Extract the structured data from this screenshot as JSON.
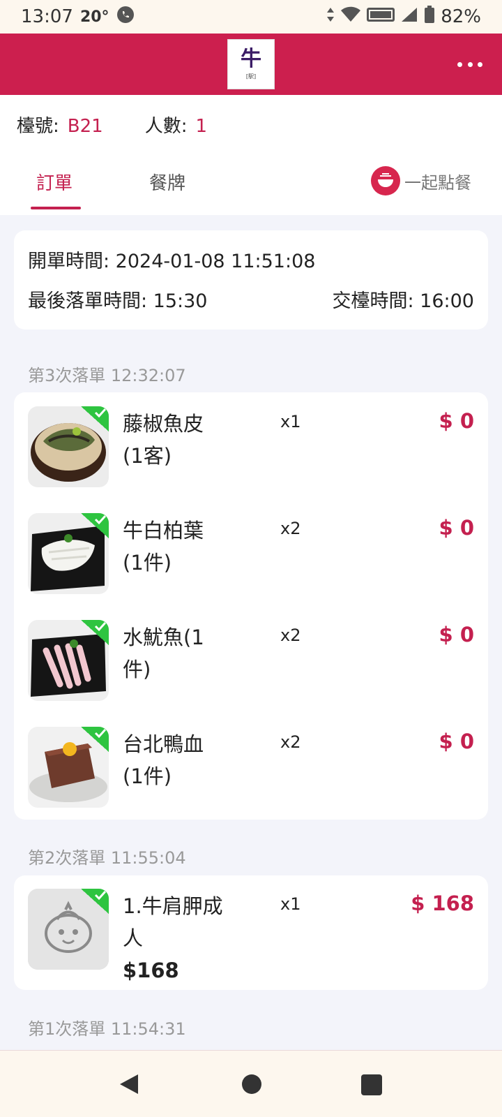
{
  "status_bar": {
    "time": "13:07",
    "temperature": "20°",
    "battery": "82%"
  },
  "app": {
    "logo_text": "牛",
    "logo_sub": "[駅]"
  },
  "table": {
    "table_label": "檯號:",
    "table_no": "B21",
    "people_label": "人數:",
    "people_count": "1"
  },
  "tabs": {
    "order": "訂單",
    "card": "餐牌",
    "together": "一起點餐"
  },
  "times": {
    "open_label": "開單時間: 2024-01-08 11:51:08",
    "last_order_label": "最後落單時間: 15:30",
    "handover_label": "交檯時間: 16:00"
  },
  "batches": [
    {
      "title": "第3次落單 12:32:07"
    },
    {
      "title": "第2次落單 11:55:04"
    },
    {
      "title": "第1次落單 11:54:31"
    }
  ],
  "items": [
    {
      "name": "藤椒魚皮(1客)",
      "qty": "x1",
      "price": "$ 0",
      "image": "fish-skin-bowl"
    },
    {
      "name": "牛白柏葉(1件)",
      "qty": "x2",
      "price": "$ 0",
      "image": "tripe-plate"
    },
    {
      "name": "水魷魚(1件)",
      "qty": "x2",
      "price": "$ 0",
      "image": "squid-plate"
    },
    {
      "name": "台北鴨血(1件)",
      "qty": "x2",
      "price": "$ 0",
      "image": "duck-blood-plate"
    },
    {
      "name": "1.牛肩胛成人",
      "sub_price": "$168",
      "qty": "x1",
      "price": "$ 168",
      "image": "placeholder-mascot"
    }
  ],
  "colors": {
    "brand": "#cc1f4e",
    "accent": "#c4204f",
    "check": "#2ec440"
  }
}
